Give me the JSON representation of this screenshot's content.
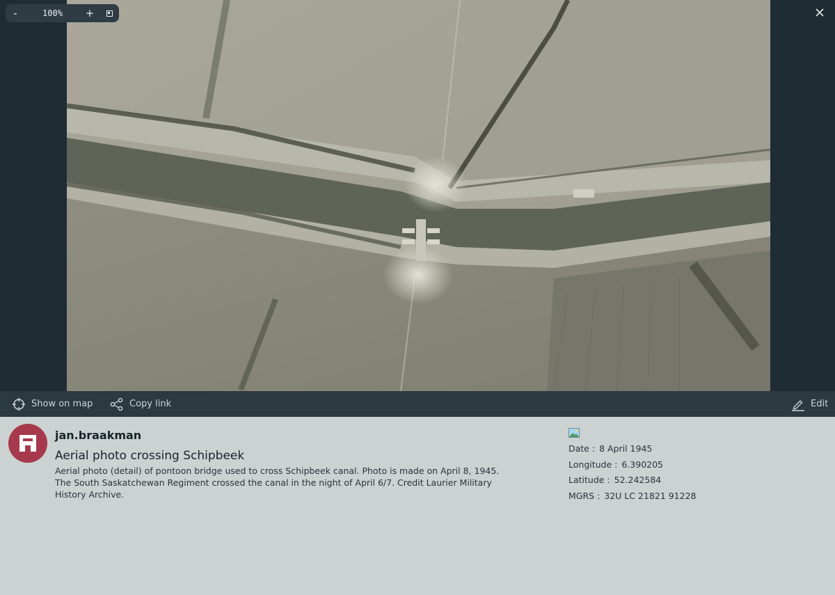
{
  "zoom": {
    "minus_label": "-",
    "level": "100%",
    "plus_label": "+"
  },
  "toolbar": {
    "show_on_map": "Show on map",
    "copy_link": "Copy link",
    "edit": "Edit"
  },
  "post": {
    "username": "jan.braakman",
    "title": "Aerial photo crossing Schipbeek",
    "description": "Aerial photo (detail) of pontoon bridge used to cross Schipbeek canal. Photo is made on April 8, 1945. The South Saskatchewan Regiment crossed the canal in the night of April 6/7. Credit Laurier Military History Archive."
  },
  "metadata": {
    "date_label": "Date :",
    "date_value": "8 April 1945",
    "longitude_label": "Longitude :",
    "longitude_value": "6.390205",
    "latitude_label": "Latitude :",
    "latitude_value": "52.242584",
    "mgrs_label": "MGRS :",
    "mgrs_value": "32U LC 21821 91228"
  },
  "colors": {
    "viewer_bg": "#1f2c34",
    "toolbar_bg": "#2b3941",
    "panel_bg": "#ccd2d1",
    "avatar_bg": "#a63a4c"
  },
  "icons": [
    "crosshair-icon",
    "share-icon",
    "pencil-icon",
    "close-icon",
    "fit-screen-icon",
    "image-icon"
  ]
}
